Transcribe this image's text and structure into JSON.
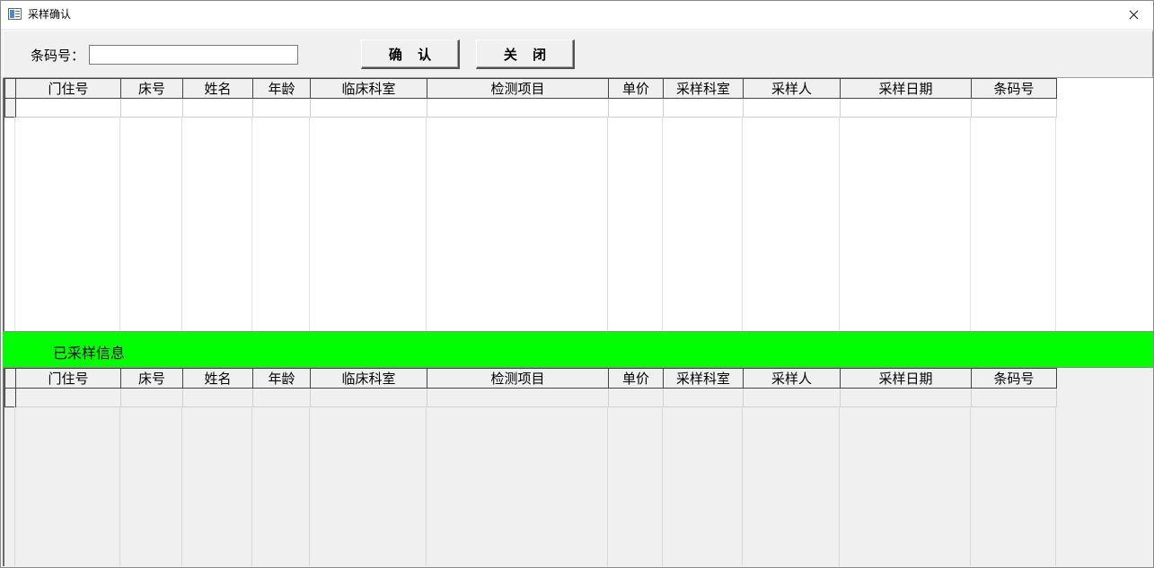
{
  "window": {
    "title": "采样确认",
    "icon": "app-window-icon",
    "close_icon": "close-icon"
  },
  "toolbar": {
    "barcode_label": "条码号：",
    "barcode_value": "",
    "confirm_label": "确 认",
    "close_label": "关 闭"
  },
  "grid_top": {
    "columns": [
      "门住号",
      "床号",
      "姓名",
      "年龄",
      "临床科室",
      "检测项目",
      "单价",
      "采样科室",
      "采样人",
      "采样日期",
      "条码号"
    ],
    "rows": [
      [
        "",
        "",
        "",
        "",
        "",
        "",
        "",
        "",
        "",
        "",
        ""
      ]
    ]
  },
  "section": {
    "sampled_label": "已采样信息"
  },
  "grid_bottom": {
    "columns": [
      "门住号",
      "床号",
      "姓名",
      "年龄",
      "临床科室",
      "检测项目",
      "单价",
      "采样科室",
      "采样人",
      "采样日期",
      "条码号"
    ],
    "rows": [
      [
        "",
        "",
        "",
        "",
        "",
        "",
        "",
        "",
        "",
        "",
        ""
      ]
    ]
  },
  "colors": {
    "section_bar": "#00ff00",
    "window_bg": "#f0f0f0",
    "grid_bg": "#ffffff"
  }
}
